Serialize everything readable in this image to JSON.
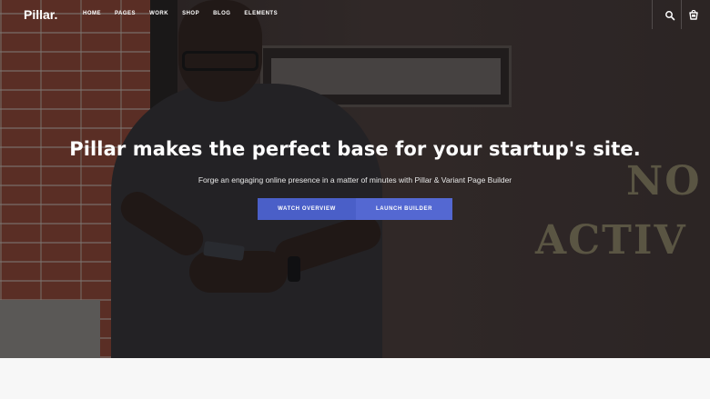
{
  "navbar": {
    "logo": "Pillar.",
    "menu": [
      {
        "label": "HOME"
      },
      {
        "label": "PAGES"
      },
      {
        "label": "WORK"
      },
      {
        "label": "SHOP"
      },
      {
        "label": "BLOG"
      },
      {
        "label": "ELEMENTS"
      }
    ],
    "icons": [
      "search-icon",
      "cart-icon"
    ]
  },
  "hero": {
    "headline": "Pillar makes the perfect base for your startup's site.",
    "subline": "Forge an engaging online presence in a matter of minutes with Pillar & Variant Page Builder",
    "buttons": [
      {
        "label": "WATCH OVERVIEW"
      },
      {
        "label": "LAUNCH BUILDER"
      }
    ],
    "background_text": [
      "NO",
      "ACTIV"
    ]
  },
  "colors": {
    "accent": "#4a5fc8",
    "accent_secondary": "#5468d2",
    "overlay": "#141216",
    "below_fold": "#f7f7f7"
  }
}
